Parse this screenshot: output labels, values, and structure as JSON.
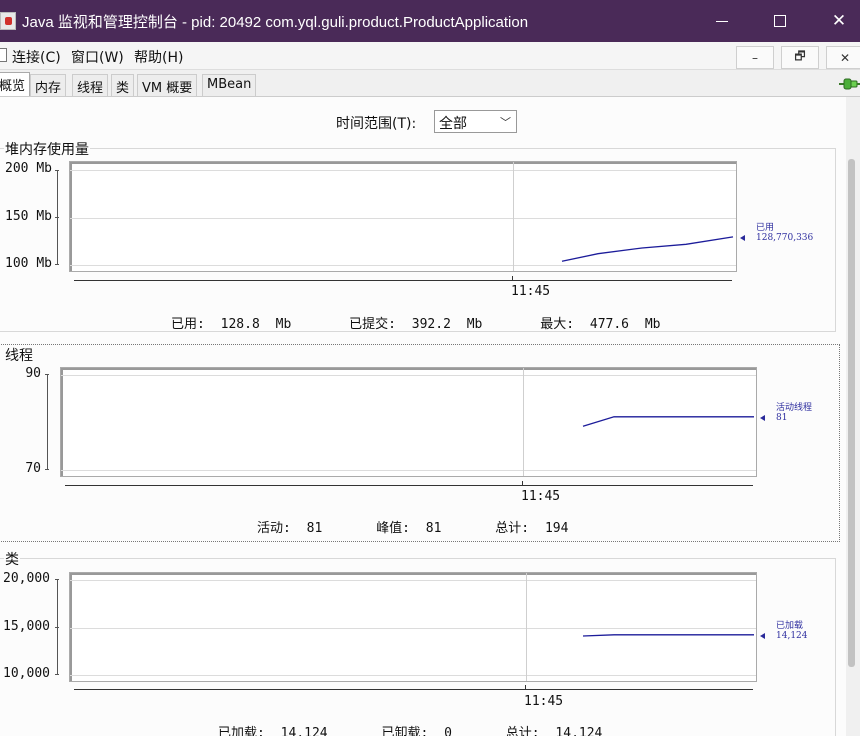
{
  "window": {
    "title": "Java 监视和管理控制台 - pid: 20492 com.yql.guli.product.ProductApplication",
    "min_label": "",
    "close_label": "✕"
  },
  "menu": {
    "items": [
      "连接(C)",
      "窗口(W)",
      "帮助(H)"
    ],
    "mdi_min": "–",
    "mdi_restore": "🗗",
    "mdi_close": "✕"
  },
  "tabs": [
    "概览",
    "内存",
    "线程",
    "类",
    "VM 概要",
    "MBean"
  ],
  "active_tab": 0,
  "time_range": {
    "label": "时间范围(T):",
    "value": "全部"
  },
  "panels": {
    "heap": {
      "title": "堆内存使用量",
      "y_ticks": [
        "200 Mb",
        "150 Mb",
        "100 Mb"
      ],
      "x_tick": "11:45",
      "legend_label": "已用",
      "legend_value": "128,770,336",
      "stats": [
        {
          "label": "已用:",
          "value": "128.8",
          "unit": "Mb"
        },
        {
          "label": "已提交:",
          "value": "392.2",
          "unit": "Mb"
        },
        {
          "label": "最大:",
          "value": "477.6",
          "unit": "Mb"
        }
      ]
    },
    "threads": {
      "title": "线程",
      "y_ticks": [
        "90",
        "70"
      ],
      "x_tick": "11:45",
      "legend_label": "活动线程",
      "legend_value": "81",
      "stats": [
        {
          "label": "活动:",
          "value": "81"
        },
        {
          "label": "峰值:",
          "value": "81"
        },
        {
          "label": "总计:",
          "value": "194"
        }
      ]
    },
    "classes": {
      "title": "类",
      "y_ticks": [
        "20,000",
        "15,000",
        "10,000"
      ],
      "x_tick": "11:45",
      "legend_label": "已加载",
      "legend_value": "14,124",
      "stats": [
        {
          "label": "已加载:",
          "value": "14,124"
        },
        {
          "label": "已卸载:",
          "value": "0"
        },
        {
          "label": "总计:",
          "value": "14,124"
        }
      ]
    }
  },
  "chart_data": [
    {
      "type": "line",
      "title": "堆内存使用量",
      "ylim": [
        100,
        200
      ],
      "y_unit": "Mb",
      "series": [
        {
          "name": "已用",
          "values": [
            103,
            111,
            117,
            121,
            128.8
          ]
        }
      ],
      "color": "#1c1c9a"
    },
    {
      "type": "line",
      "title": "线程",
      "ylim": [
        70,
        90
      ],
      "series": [
        {
          "name": "活动线程",
          "values": [
            79,
            81,
            81,
            81,
            81
          ]
        }
      ],
      "color": "#1c1c9a"
    },
    {
      "type": "line",
      "title": "类",
      "ylim": [
        10000,
        20000
      ],
      "series": [
        {
          "name": "已加载",
          "values": [
            14000,
            14124,
            14124,
            14124,
            14124
          ]
        }
      ],
      "color": "#1c1c9a"
    }
  ]
}
